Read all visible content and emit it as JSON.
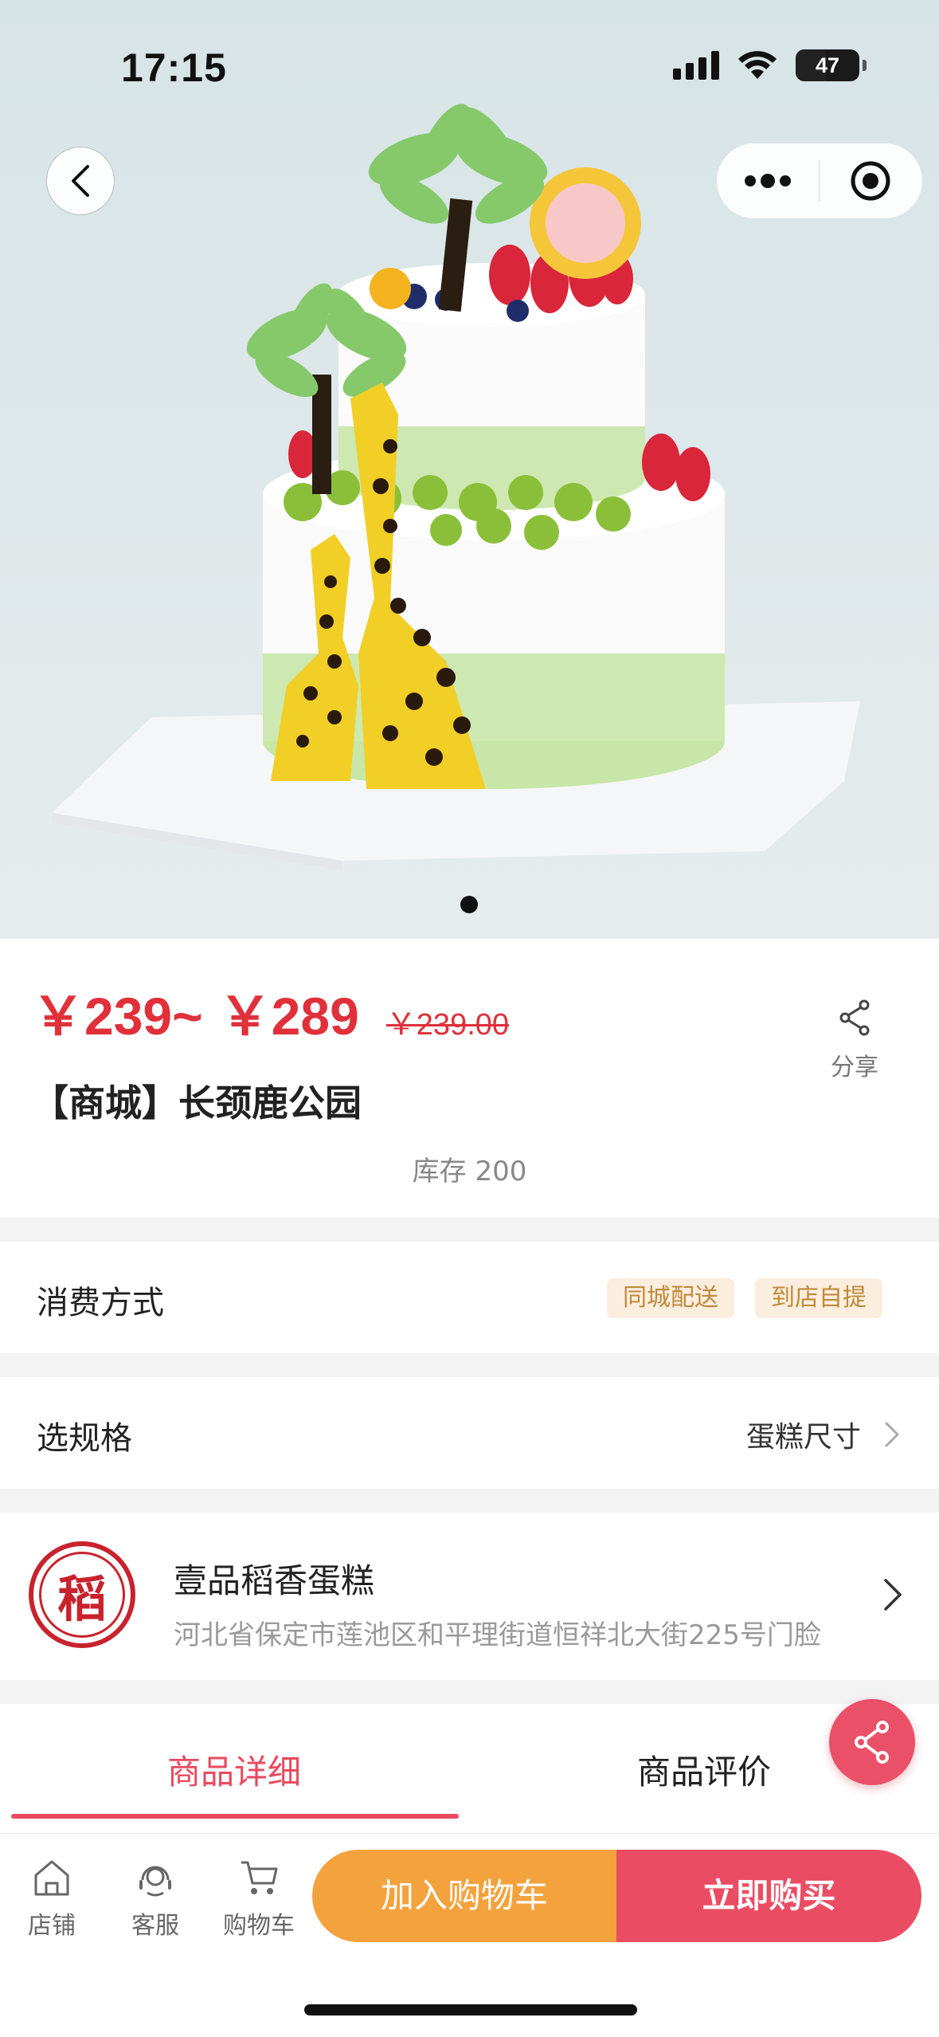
{
  "status_bar": {
    "time": "17:15",
    "battery": "47"
  },
  "hero": {
    "slide_count": 1,
    "active_slide": 1
  },
  "product": {
    "price_low": "￥239~",
    "price_high": "￥289",
    "original_price": "￥239.00",
    "title": "【商城】长颈鹿公园",
    "stock_label": "库存",
    "stock_value": "200",
    "share_label": "分享"
  },
  "consume": {
    "label": "消费方式",
    "tags": [
      "同城配送",
      "到店自提"
    ]
  },
  "spec": {
    "label": "选规格",
    "value": "蛋糕尺寸"
  },
  "store": {
    "logo_char": "稻",
    "name": "壹品稻香蛋糕",
    "address": "河北省保定市莲池区和平理街道恒祥北大街225号门脸"
  },
  "tabs": [
    {
      "label": "商品详细",
      "active": true
    },
    {
      "label": "商品评价",
      "active": false
    }
  ],
  "bottom_nav": [
    {
      "label": "店铺",
      "icon": "store-icon"
    },
    {
      "label": "客服",
      "icon": "customer-service-icon"
    },
    {
      "label": "购物车",
      "icon": "cart-icon"
    }
  ],
  "actions": {
    "add_to_cart": "加入购物车",
    "buy_now": "立即购买"
  },
  "colors": {
    "price_red": "#e0303a",
    "accent_pink": "#ea4d63",
    "cart_orange": "#f4a23d",
    "tag_bg": "#fbeede",
    "tag_text": "#c08a3a"
  }
}
